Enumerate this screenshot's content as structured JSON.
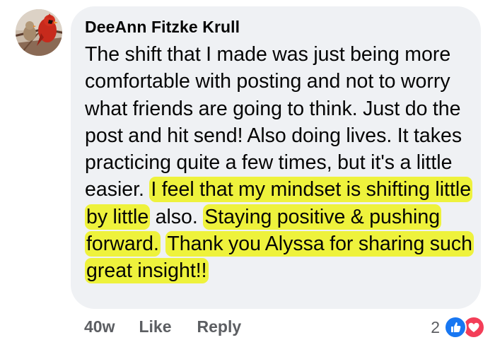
{
  "comment": {
    "author": "DeeAnn Fitzke Krull",
    "text_part1": "The shift that I made was just being more comfortable with posting and not to worry what friends are going to think. Just do the post and hit send!  Also doing lives.  It takes practicing quite a few times, but it's a little easier. ",
    "highlight1": "I feel that my mindset is shifting little by little",
    "text_part2": " also. ",
    "highlight2": "Staying positive & pushing forward.",
    "text_part3": "  ",
    "highlight3": "Thank you Alyssa for sharing such great insight!!"
  },
  "actions": {
    "age": "40w",
    "like_label": "Like",
    "reply_label": "Reply"
  },
  "reactions": {
    "count": "2",
    "types": [
      "like-icon",
      "love-icon"
    ],
    "colors": {
      "like": "#1877f2",
      "love": "#f33e58",
      "highlight": "#eef23c",
      "bubble": "#eff1f4"
    }
  }
}
